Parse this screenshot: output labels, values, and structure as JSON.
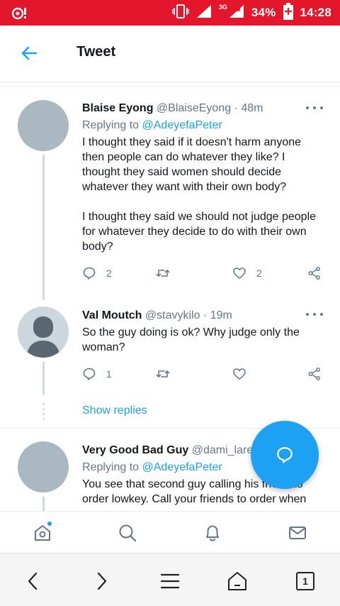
{
  "status_bar": {
    "network": "3G",
    "battery": "34%",
    "time": "14:28",
    "bar_color": "#e3162b"
  },
  "header": {
    "title": "Tweet",
    "back_icon": "arrow-left-icon"
  },
  "tweets": [
    {
      "name": "Blaise Eyong",
      "handle": "@BlaiseEyong",
      "separator": "·",
      "time": "48m",
      "replying_prefix": "Replying to",
      "replying_to": "@AdeyefaPeter",
      "paragraphs": [
        "I thought they said if it doesn't harm anyone then people can do whatever they like? I thought they said women should decide whatever they want with their own body?",
        "I thought they said we should not judge people for whatever they decide to do with their own body?"
      ],
      "reply_count": "2",
      "retweet_count": "",
      "like_count": "2"
    },
    {
      "name": "Val Moutch",
      "handle": "@stavykilo",
      "separator": "·",
      "time": "19m",
      "text": "So the guy doing is ok?  Why judge only the woman?",
      "reply_count": "1",
      "retweet_count": "",
      "like_count": ""
    },
    {
      "name": "Very Good Bad Guy",
      "handle": "@dami_lare",
      "replying_prefix": "Replying to",
      "replying_to": "@AdeyefaPeter",
      "text_lines": [
        "You see that second guy calling his friend to",
        "order lowkey. Call your friends to order when"
      ]
    }
  ],
  "show_replies": "Show replies",
  "accent_color": "#1da1f2",
  "bottom_tabs": [
    "home-icon",
    "search-icon",
    "notifications-icon",
    "messages-icon"
  ],
  "browser_nav": {
    "tab_count": "1"
  }
}
